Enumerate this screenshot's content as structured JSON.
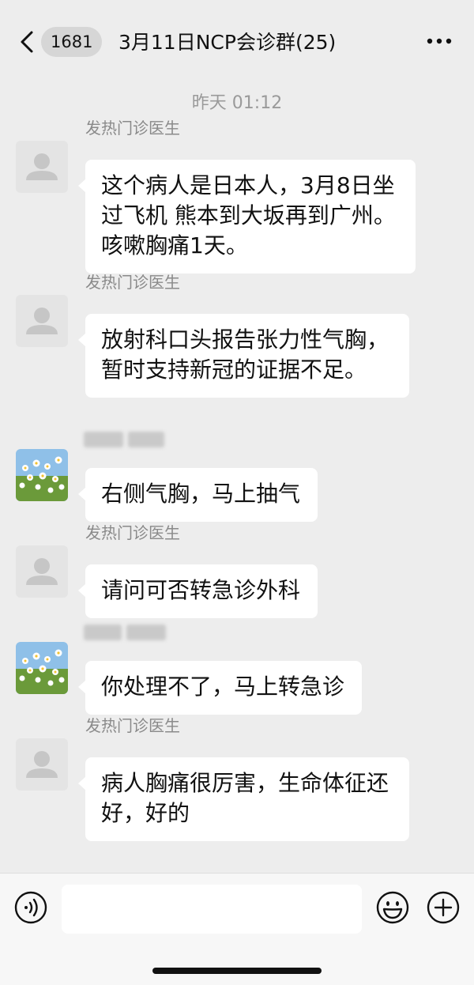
{
  "header": {
    "back_icon": "chevron-left-icon",
    "unread_count": "1681",
    "title": "3月11日NCP会诊群(25)",
    "more_icon": "more-dots-icon"
  },
  "timestamp": "昨天 01:12",
  "messages": [
    {
      "sender": "发热门诊医生",
      "avatar": "default-avatar",
      "text": "这个病人是日本人，3月8日坐过飞机 熊本到大坂再到广州。咳嗽胸痛1天。"
    },
    {
      "sender": "发热门诊医生",
      "avatar": "default-avatar",
      "text": "放射科口头报告张力性气胸，暂时支持新冠的证据不足。"
    },
    {
      "sender": "",
      "avatar": "daisy-photo-avatar",
      "text": "右侧气胸，马上抽气"
    },
    {
      "sender": "发热门诊医生",
      "avatar": "default-avatar",
      "text": "请问可否转急诊外科"
    },
    {
      "sender": "",
      "avatar": "daisy-photo-avatar",
      "text": "你处理不了，马上转急诊"
    },
    {
      "sender": "发热门诊医生",
      "avatar": "default-avatar",
      "text": "病人胸痛很厉害，生命体征还好，好的"
    }
  ],
  "input_bar": {
    "voice_icon": "voice-icon",
    "input_value": "",
    "emoji_icon": "emoji-icon",
    "plus_icon": "plus-icon"
  },
  "colors": {
    "background": "#ededed",
    "bubble": "#ffffff",
    "timestamp_text": "#9a9a9a",
    "sender_text": "#8a8a8a"
  }
}
